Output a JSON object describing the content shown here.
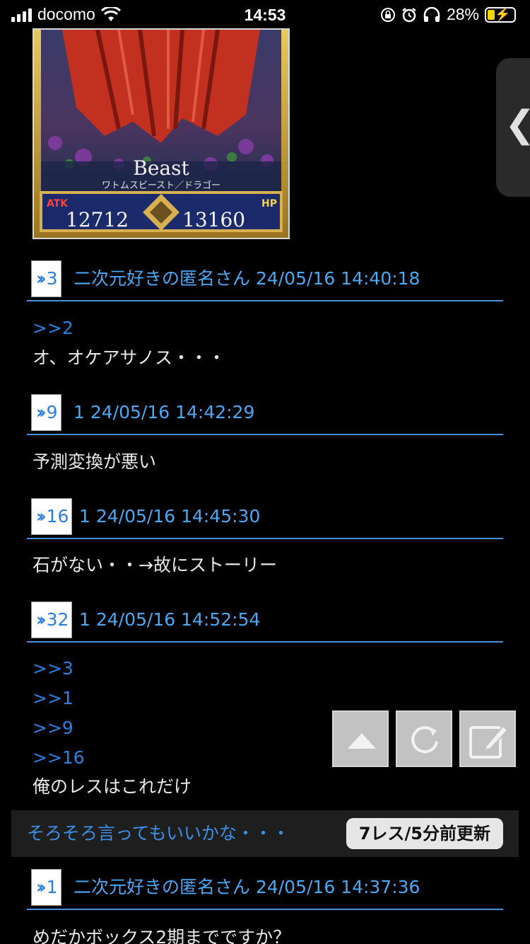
{
  "status_bar": {
    "carrier": "docomo",
    "time": "14:53",
    "battery": "28%",
    "battery_level": 0.28
  },
  "card_image": {
    "class_label": "Beast",
    "subtitle": "ワトムスビースト／ドラゴー",
    "atk_label": "ATK",
    "atk": "12712",
    "hp_label": "HP",
    "hp": "13160"
  },
  "posts": [
    {
      "num": "3",
      "meta": "二次元好きの匿名さん 24/05/16 14:40:18",
      "lines": [
        {
          "text": ">>2",
          "kind": "anchor"
        },
        {
          "text": "オ、オケアサノス・・・",
          "kind": "text"
        }
      ]
    },
    {
      "num": "9",
      "meta": "1 24/05/16 14:42:29",
      "lines": [
        {
          "text": "予測変換が悪い",
          "kind": "text"
        }
      ]
    },
    {
      "num": "16",
      "meta": "1 24/05/16 14:45:30",
      "lines": [
        {
          "text": "石がない・・→故にストーリー",
          "kind": "text"
        }
      ]
    },
    {
      "num": "32",
      "meta": "1 24/05/16 14:52:54",
      "lines": [
        {
          "text": ">>3",
          "kind": "anchor"
        },
        {
          "text": ">>1",
          "kind": "anchor"
        },
        {
          "text": ">>9",
          "kind": "anchor"
        },
        {
          "text": ">>16",
          "kind": "anchor"
        },
        {
          "text": "俺のレスはこれだけ",
          "kind": "text"
        }
      ]
    }
  ],
  "next_thread": {
    "title": "そろそろ言ってもいいかな・・・",
    "badge": "7レス/5分前更新",
    "first_post": {
      "num": "1",
      "meta": "二次元好きの匿名さん 24/05/16 14:37:36",
      "line": "めだかボックス2期までですか？"
    }
  },
  "actions": {
    "scroll_top_icon": "triangle-up-icon",
    "reload_icon": "reload-icon",
    "compose_icon": "edit-icon"
  },
  "colors": {
    "accent_blue": "#4aa8f5",
    "anchor_blue": "#2a7fe0",
    "divider_blue": "#4a90e2",
    "battery_yellow": "#f5d400"
  }
}
